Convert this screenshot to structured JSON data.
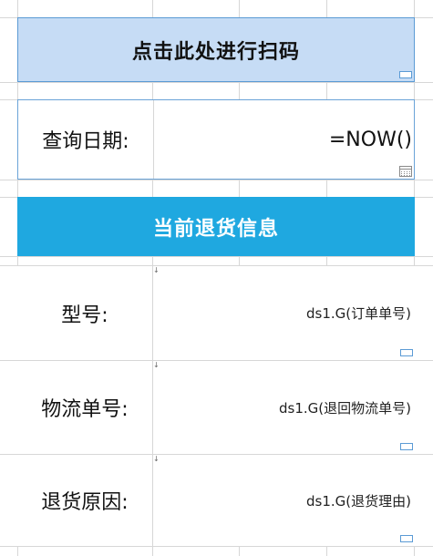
{
  "banner": {
    "label": "点击此处进行扫码"
  },
  "query_date": {
    "label": "查询日期:",
    "value": "=NOW()"
  },
  "section_header": {
    "title": "当前退货信息"
  },
  "fields": {
    "model": {
      "label": "型号:",
      "value": "ds1.G(订单单号)"
    },
    "tracking_number": {
      "label": "物流单号:",
      "value": "ds1.G(退回物流单号)"
    },
    "return_reason": {
      "label": "退货原因:",
      "value": "ds1.G(退货理由)"
    }
  },
  "colors": {
    "banner_bg": "#c6dcf5",
    "banner_border": "#5b9bd5",
    "section_header_bg": "#1fa8e0",
    "gridline": "#d7d7d7"
  },
  "icons": {
    "cell_handle": "resize-handle-icon",
    "date_picker": "calendar-icon",
    "comment": "comment-marker-icon"
  }
}
